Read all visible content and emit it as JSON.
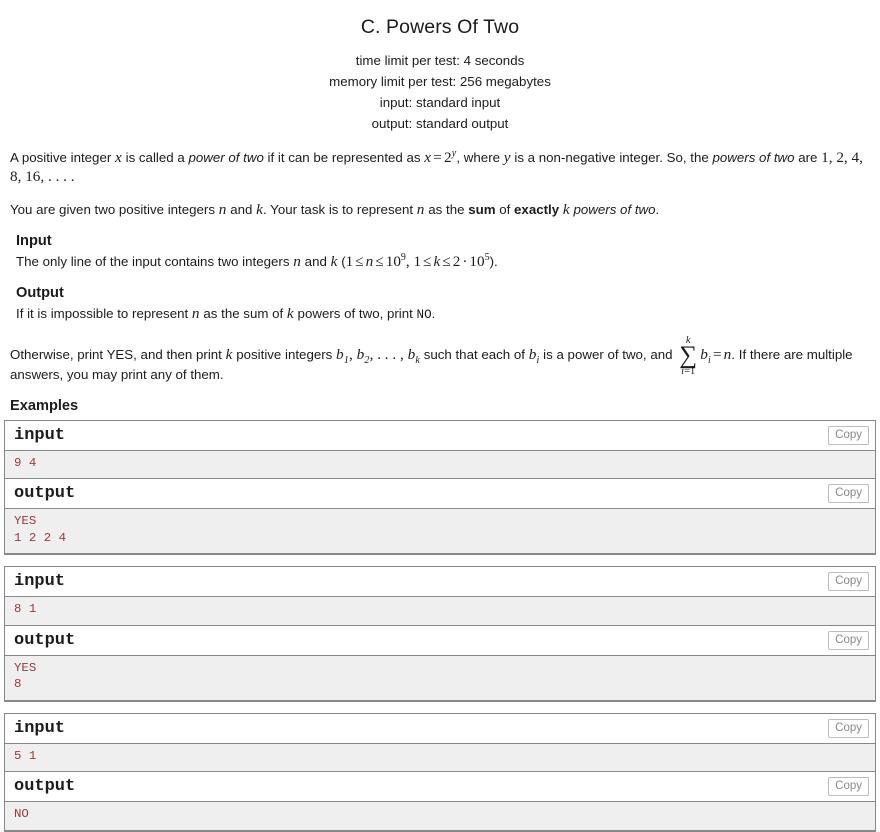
{
  "header": {
    "title": "C. Powers Of Two",
    "time_limit": "time limit per test: 4 seconds",
    "memory_limit": "memory limit per test: 256 megabytes",
    "input_spec": "input: standard input",
    "output_spec": "output: standard output"
  },
  "statement": {
    "p1_a": "A positive integer ",
    "p1_x": "x",
    "p1_b": " is called a ",
    "p1_pot1": "power of two",
    "p1_c": " if it can be represented as ",
    "p1_math_x": "x",
    "p1_math_eq": "=",
    "p1_math_two": "2",
    "p1_math_y": "y",
    "p1_d": ", where ",
    "p1_y": "y",
    "p1_e": " is a non-negative integer. So, the ",
    "p1_pot2": "powers of two",
    "p1_f": " are ",
    "p1_list": "1, 2, 4, 8, 16, . . . .",
    "p2_a": "You are given two positive integers ",
    "p2_n": "n",
    "p2_b": " and ",
    "p2_k": "k",
    "p2_c": ". Your task is to represent ",
    "p2_n2": "n",
    "p2_d": " as the ",
    "p2_sum": "sum",
    "p2_e": " of ",
    "p2_exactly": "exactly",
    "p2_f": " ",
    "p2_k2": "k",
    "p2_g": " ",
    "p2_pot": "powers of two",
    "p2_h": "."
  },
  "input_section": {
    "heading": "Input",
    "text_a": "The only line of the input contains two integers ",
    "var_n": "n",
    "text_b": " and ",
    "var_k": "k",
    "text_c": " (",
    "c_one_a": "1",
    "c_le1": "≤",
    "c_n": "n",
    "c_le2": "≤",
    "c_ten": "10",
    "c_exp9": "9",
    "c_comma": ", ",
    "c_one_b": "1",
    "c_le3": "≤",
    "c_k": "k",
    "c_le4": "≤",
    "c_two": "2",
    "c_dot": "·",
    "c_ten2": "10",
    "c_exp5": "5",
    "text_d": ")."
  },
  "output_section": {
    "heading": "Output",
    "p1_a": "If it is impossible to represent ",
    "p1_n": "n",
    "p1_b": " as the sum of ",
    "p1_k": "k",
    "p1_c": " powers of two, print ",
    "p1_no": "NO",
    "p1_d": ".",
    "p2_a": "Otherwise, print YES, and then print ",
    "p2_k": "k",
    "p2_b": " positive integers ",
    "p2_b1": "b",
    "p2_b1s": "1",
    "p2_comma1": ", ",
    "p2_b2": "b",
    "p2_b2s": "2",
    "p2_comma2": ", . . . , ",
    "p2_bk": "b",
    "p2_bks": "k",
    "p2_c": " such that each of ",
    "p2_bi": "b",
    "p2_bis": "i",
    "p2_d": " is a power of two, and ",
    "sum_top": "k",
    "sum_sigma": "∑",
    "sum_bot_i": "i",
    "sum_bot_eq": "=1",
    "sum_b": "b",
    "sum_bs": "i",
    "sum_eq": "=",
    "sum_n": "n",
    "p2_e": ". If there are multiple answers, you may print any of them."
  },
  "examples": {
    "heading": "Examples",
    "input_label": "input",
    "output_label": "output",
    "copy_label": "Copy",
    "tests": [
      {
        "input": "9 4",
        "output": "YES\n1 2 2 4"
      },
      {
        "input": "8 1",
        "output": "YES\n8"
      },
      {
        "input": "5 1",
        "output": "NO"
      }
    ]
  },
  "colors": {
    "data_text": "#9b3a3a",
    "data_bg": "#efeff0",
    "border": "#888888",
    "copy_text": "#8a8a8a"
  }
}
